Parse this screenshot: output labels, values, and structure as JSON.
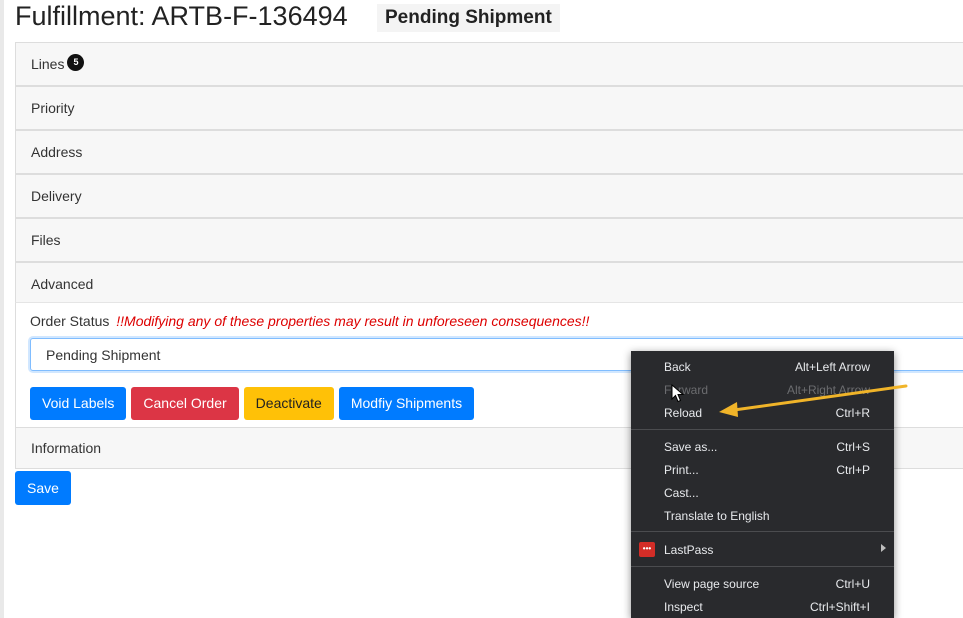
{
  "header": {
    "title": "Fulfillment: ARTB-F-136494",
    "status_badge": "Pending Shipment"
  },
  "accordion": {
    "items": [
      {
        "label": "Lines",
        "badge": "5"
      },
      {
        "label": "Priority"
      },
      {
        "label": "Address"
      },
      {
        "label": "Delivery"
      },
      {
        "label": "Files"
      },
      {
        "label": "Advanced"
      }
    ]
  },
  "advanced": {
    "order_status_label": "Order Status",
    "warning": "!!Modifying any of these properties may result in unforeseen consequences!!",
    "status_value": "Pending Shipment",
    "buttons": {
      "void_labels": "Void Labels",
      "cancel_order": "Cancel Order",
      "deactivate": "Deactivate",
      "modify_shipments": "Modfiy Shipments"
    }
  },
  "information": {
    "label": "Information"
  },
  "save_label": "Save",
  "context_menu": {
    "items": [
      {
        "label": "Back",
        "shortcut": "Alt+Left Arrow"
      },
      {
        "label": "Forward",
        "shortcut": "Alt+Right Arrow",
        "disabled": true
      },
      {
        "label": "Reload",
        "shortcut": "Ctrl+R"
      },
      {
        "label": "Save as...",
        "shortcut": "Ctrl+S"
      },
      {
        "label": "Print...",
        "shortcut": "Ctrl+P"
      },
      {
        "label": "Cast..."
      },
      {
        "label": "Translate to English"
      },
      {
        "label": "LastPass",
        "icon": "lastpass-icon",
        "submenu": true
      },
      {
        "label": "View page source",
        "shortcut": "Ctrl+U"
      },
      {
        "label": "Inspect",
        "shortcut": "Ctrl+Shift+I"
      }
    ]
  },
  "colors": {
    "primary": "#007bff",
    "danger": "#dc3545",
    "warning": "#ffc107",
    "menu_bg": "#292a2d",
    "annotation_arrow": "#f0b429"
  }
}
